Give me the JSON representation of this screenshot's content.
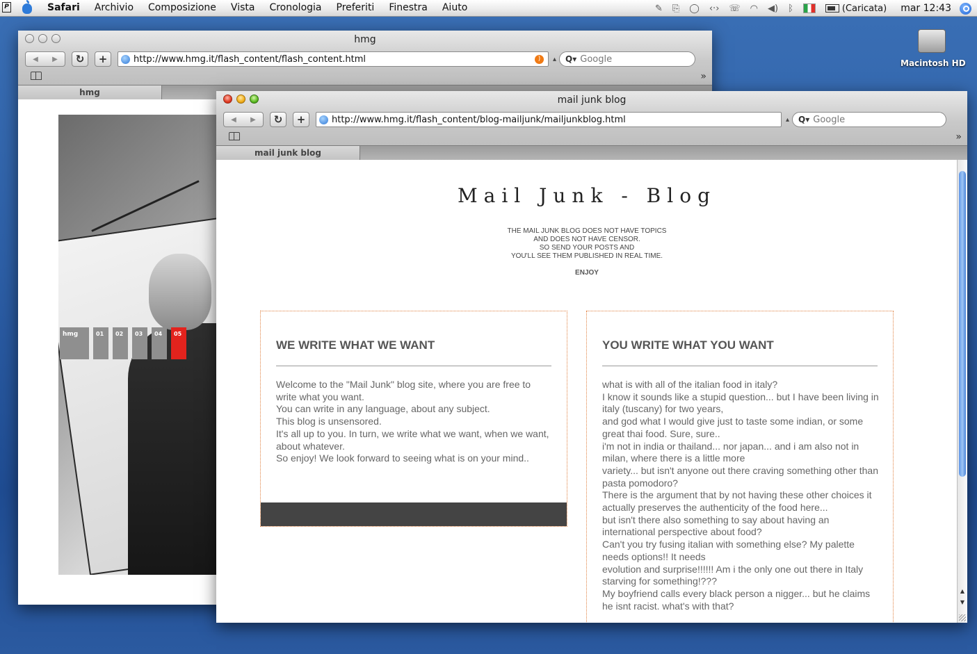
{
  "menubar": {
    "app_name": "Safari",
    "menus": [
      "Archivio",
      "Composizione",
      "Vista",
      "Cronologia",
      "Preferiti",
      "Finestra",
      "Aiuto"
    ],
    "battery_status": "(Caricata)",
    "clock": "mar 12:43",
    "flag_label": "PRO"
  },
  "desktop": {
    "hd_label": "Macintosh HD"
  },
  "back_window": {
    "title": "hmg",
    "url": "http://www.hmg.it/flash_content/flash_content.html",
    "search_placeholder": "Google",
    "tab_label": "hmg",
    "nav_items": [
      "hmg",
      "01",
      "02",
      "03",
      "04",
      "05"
    ],
    "active_nav": "05",
    "accent_color": "#e3231d"
  },
  "front_window": {
    "title": "mail junk blog",
    "url": "http://www.hmg.it/flash_content/blog-mailjunk/mailjunkblog.html",
    "search_placeholder": "Google",
    "tab_label": "mail junk blog"
  },
  "blog": {
    "title": "Mail Junk - Blog",
    "intro_lines": [
      "THE MAIL JUNK BLOG DOES NOT HAVE TOPICS",
      "AND DOES NOT HAVE CENSOR.",
      "SO SEND YOUR POSTS AND",
      "YOU'LL SEE THEM PUBLISHED IN REAL TIME."
    ],
    "enjoy": "ENJOY",
    "left_box": {
      "heading": "WE WRITE WHAT WE WANT",
      "lines": [
        "Welcome to the \"Mail Junk\" blog site, where you are free to write what you want.",
        "You can write in any language, about any subject.",
        "This blog is unsensored.",
        "It's all up to you. In turn, we write what we want, when we want, about whatever.",
        "So enjoy! We look forward to seeing what is on your mind.."
      ]
    },
    "right_box": {
      "heading": "YOU WRITE WHAT YOU WANT",
      "lines": [
        "what is with all of the italian food in italy?",
        "I know it sounds like a stupid question... but I have been living in italy (tuscany) for two years,",
        "and god what I would give just to taste some indian, or some great thai food. Sure, sure..",
        "i'm not in india or thailand... nor japan... and i am also not in milan, where there is a little more",
        "variety... but isn't anyone out there craving something other than pasta pomodoro?",
        "There is the argument that by not having these other choices it actually preserves the authenticity of the food here...",
        "but isn't there also something to say about having an international perspective about food?",
        "Can't you try fusing italian with something else? My palette needs options!! It needs",
        "evolution and surprise!!!!!! Am i the only one out there in Italy starving for something!???",
        "My boyfriend calls every black person a nigger... but he claims he isnt racist. what's with that?"
      ]
    }
  }
}
